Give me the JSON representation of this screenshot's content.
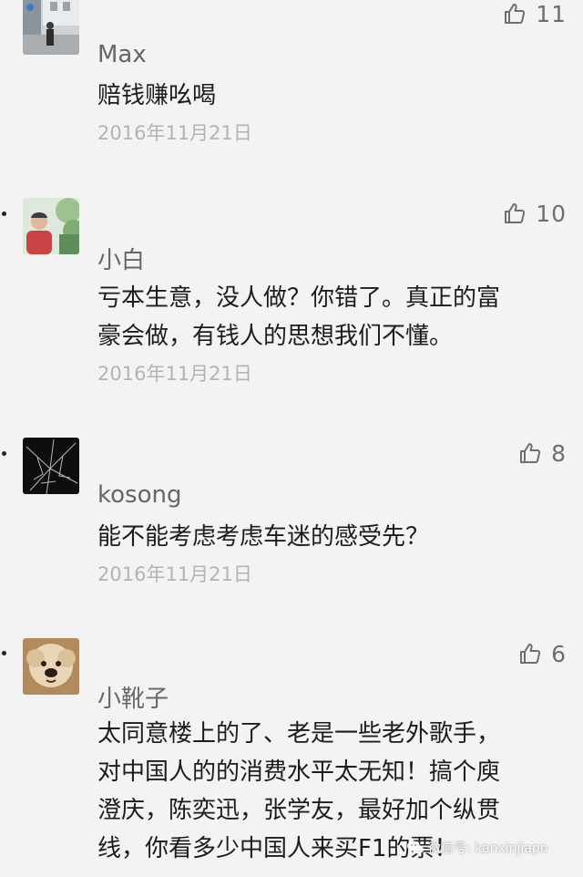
{
  "comments": [
    {
      "author": "Max",
      "text_lines": [
        "赔钱赚吆喝"
      ],
      "date": "2016年11月21日",
      "likes": "11",
      "avatar": "street-photo"
    },
    {
      "author": "小白",
      "text_lines": [
        "亏本生意，没人做？你错了。真正的富",
        "豪会做，有钱人的思想我们不懂。"
      ],
      "date": "2016年11月21日",
      "likes": "10",
      "avatar": "person-outdoors"
    },
    {
      "author": "kosong",
      "text_lines": [
        "能不能考虑考虑车迷的感受先？"
      ],
      "date": "2016年11月21日",
      "likes": "8",
      "avatar": "cracked-screen"
    },
    {
      "author": "小靴子",
      "text_lines": [
        "太同意楼上的了、老是一些老外歌手，",
        "对中国人的的消费水平太无知！搞个庾",
        "澄庆，陈奕迅，张学友，最好加个纵贯",
        "线，你看多少中国人来买F1的票！"
      ],
      "date": "",
      "likes": "6",
      "avatar": "puppy"
    }
  ],
  "watermark": {
    "text": "微信号: kanxinjiapo"
  },
  "colors": {
    "background": "#f3f3f3",
    "like_icon": "#6e6e6e",
    "date_text": "#b3b3b3",
    "author_text": "#666666"
  }
}
